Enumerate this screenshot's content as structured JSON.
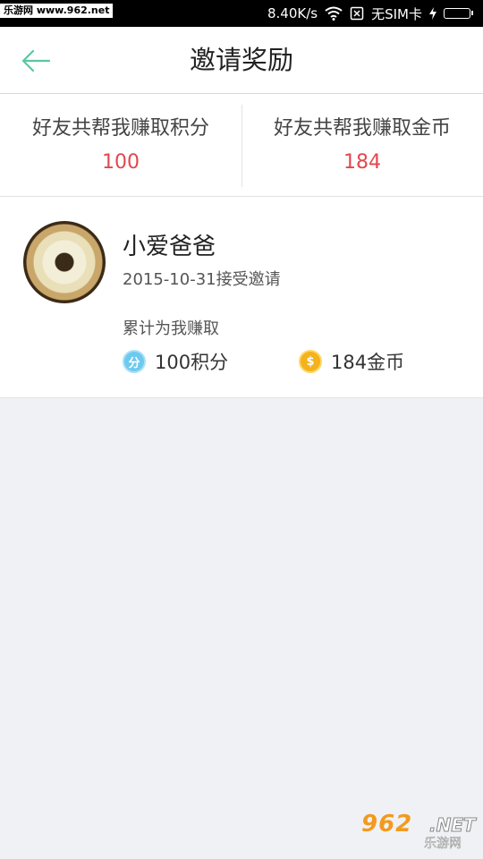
{
  "status_bar": {
    "watermark": "乐游网 www.962.net",
    "speed": "8.40K/s",
    "sim": "无SIM卡"
  },
  "header": {
    "title": "邀请奖励",
    "back_icon": "arrow-left-icon"
  },
  "stats": [
    {
      "label": "好友共帮我赚取积分",
      "value": "100"
    },
    {
      "label": "好友共帮我赚取金币",
      "value": "184"
    }
  ],
  "invite": {
    "name": "小爱爸爸",
    "date_text": "2015-10-31接受邀请",
    "earned_label": "累计为我赚取",
    "points_icon_text": "分",
    "points_text": "100积分",
    "coins_icon_text": "$",
    "coins_text": "184金币"
  },
  "watermark_bottom": {
    "number": "962",
    "net": ".NET",
    "sub": "乐游网"
  },
  "colors": {
    "accent_green": "#5cc6a2",
    "value_red": "#e2474d",
    "points_blue": "#6ec9ef",
    "coin_gold": "#f4b21c"
  }
}
